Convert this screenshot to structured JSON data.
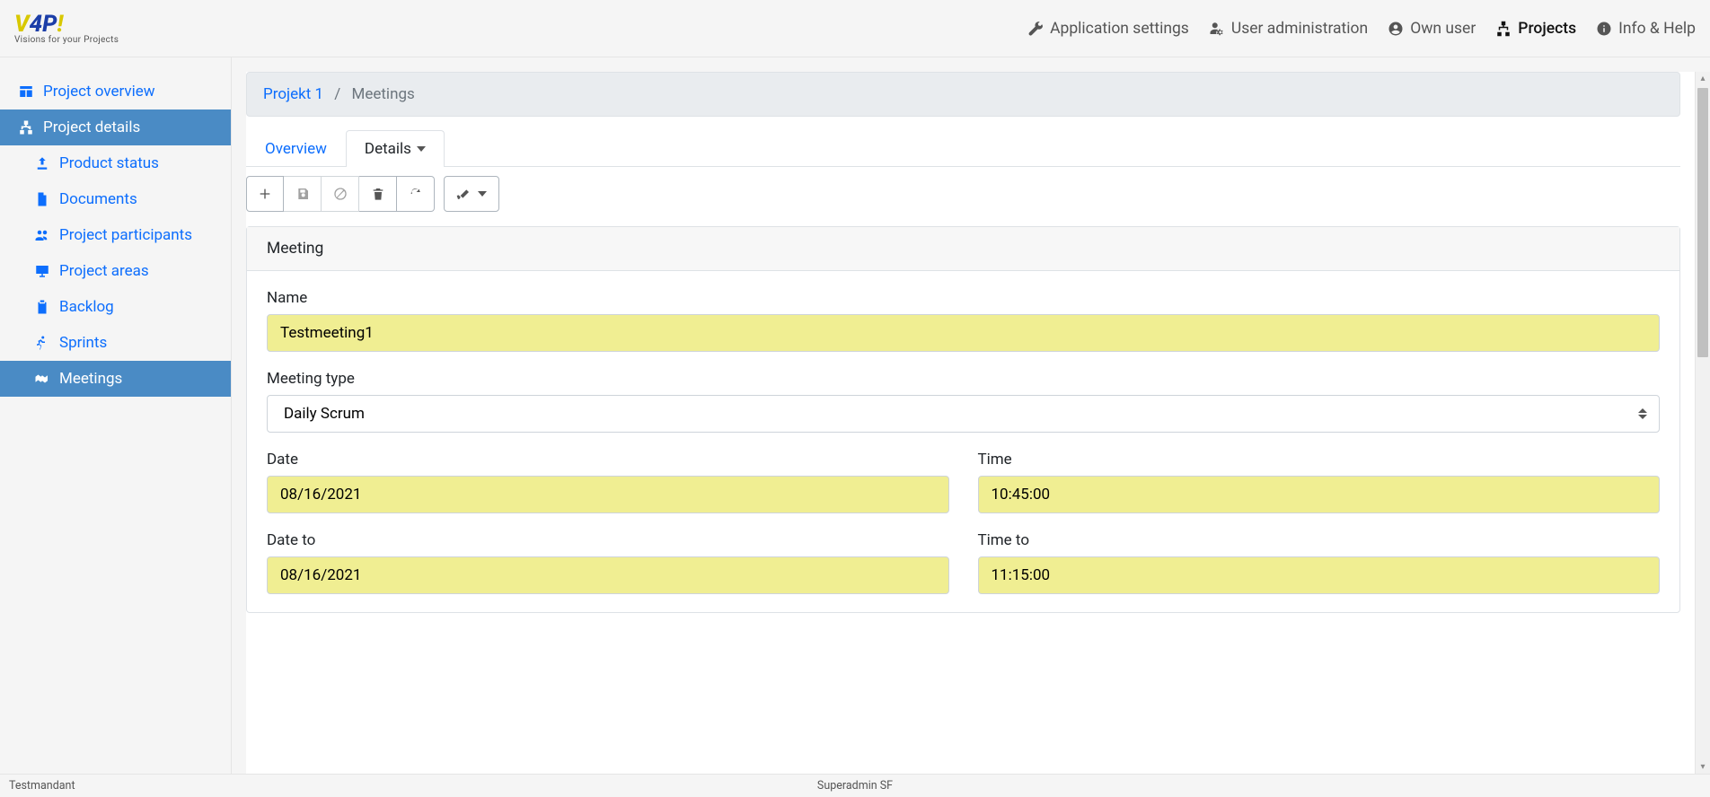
{
  "logo": {
    "product_name": "V4P!",
    "tagline": "Visions for your Projects"
  },
  "topnav": {
    "app_settings": "Application settings",
    "user_admin": "User administration",
    "own_user": "Own user",
    "projects": "Projects",
    "info_help": "Info & Help"
  },
  "sidebar": {
    "project_overview": "Project overview",
    "project_details": "Project details",
    "product_status": "Product status",
    "documents": "Documents",
    "project_participants": "Project participants",
    "project_areas": "Project areas",
    "backlog": "Backlog",
    "sprints": "Sprints",
    "meetings": "Meetings"
  },
  "breadcrumb": {
    "project": "Projekt 1",
    "current": "Meetings"
  },
  "tabs": {
    "overview": "Overview",
    "details": "Details"
  },
  "form": {
    "panel_title": "Meeting",
    "labels": {
      "name": "Name",
      "meeting_type": "Meeting type",
      "date": "Date",
      "time": "Time",
      "date_to": "Date to",
      "time_to": "Time to"
    },
    "values": {
      "name": "Testmeeting1",
      "meeting_type": "Daily Scrum",
      "date": "08/16/2021",
      "time": "10:45:00",
      "date_to": "08/16/2021",
      "time_to": "11:15:00"
    }
  },
  "footer": {
    "tenant": "Testmandant",
    "user": "Superadmin SF"
  }
}
